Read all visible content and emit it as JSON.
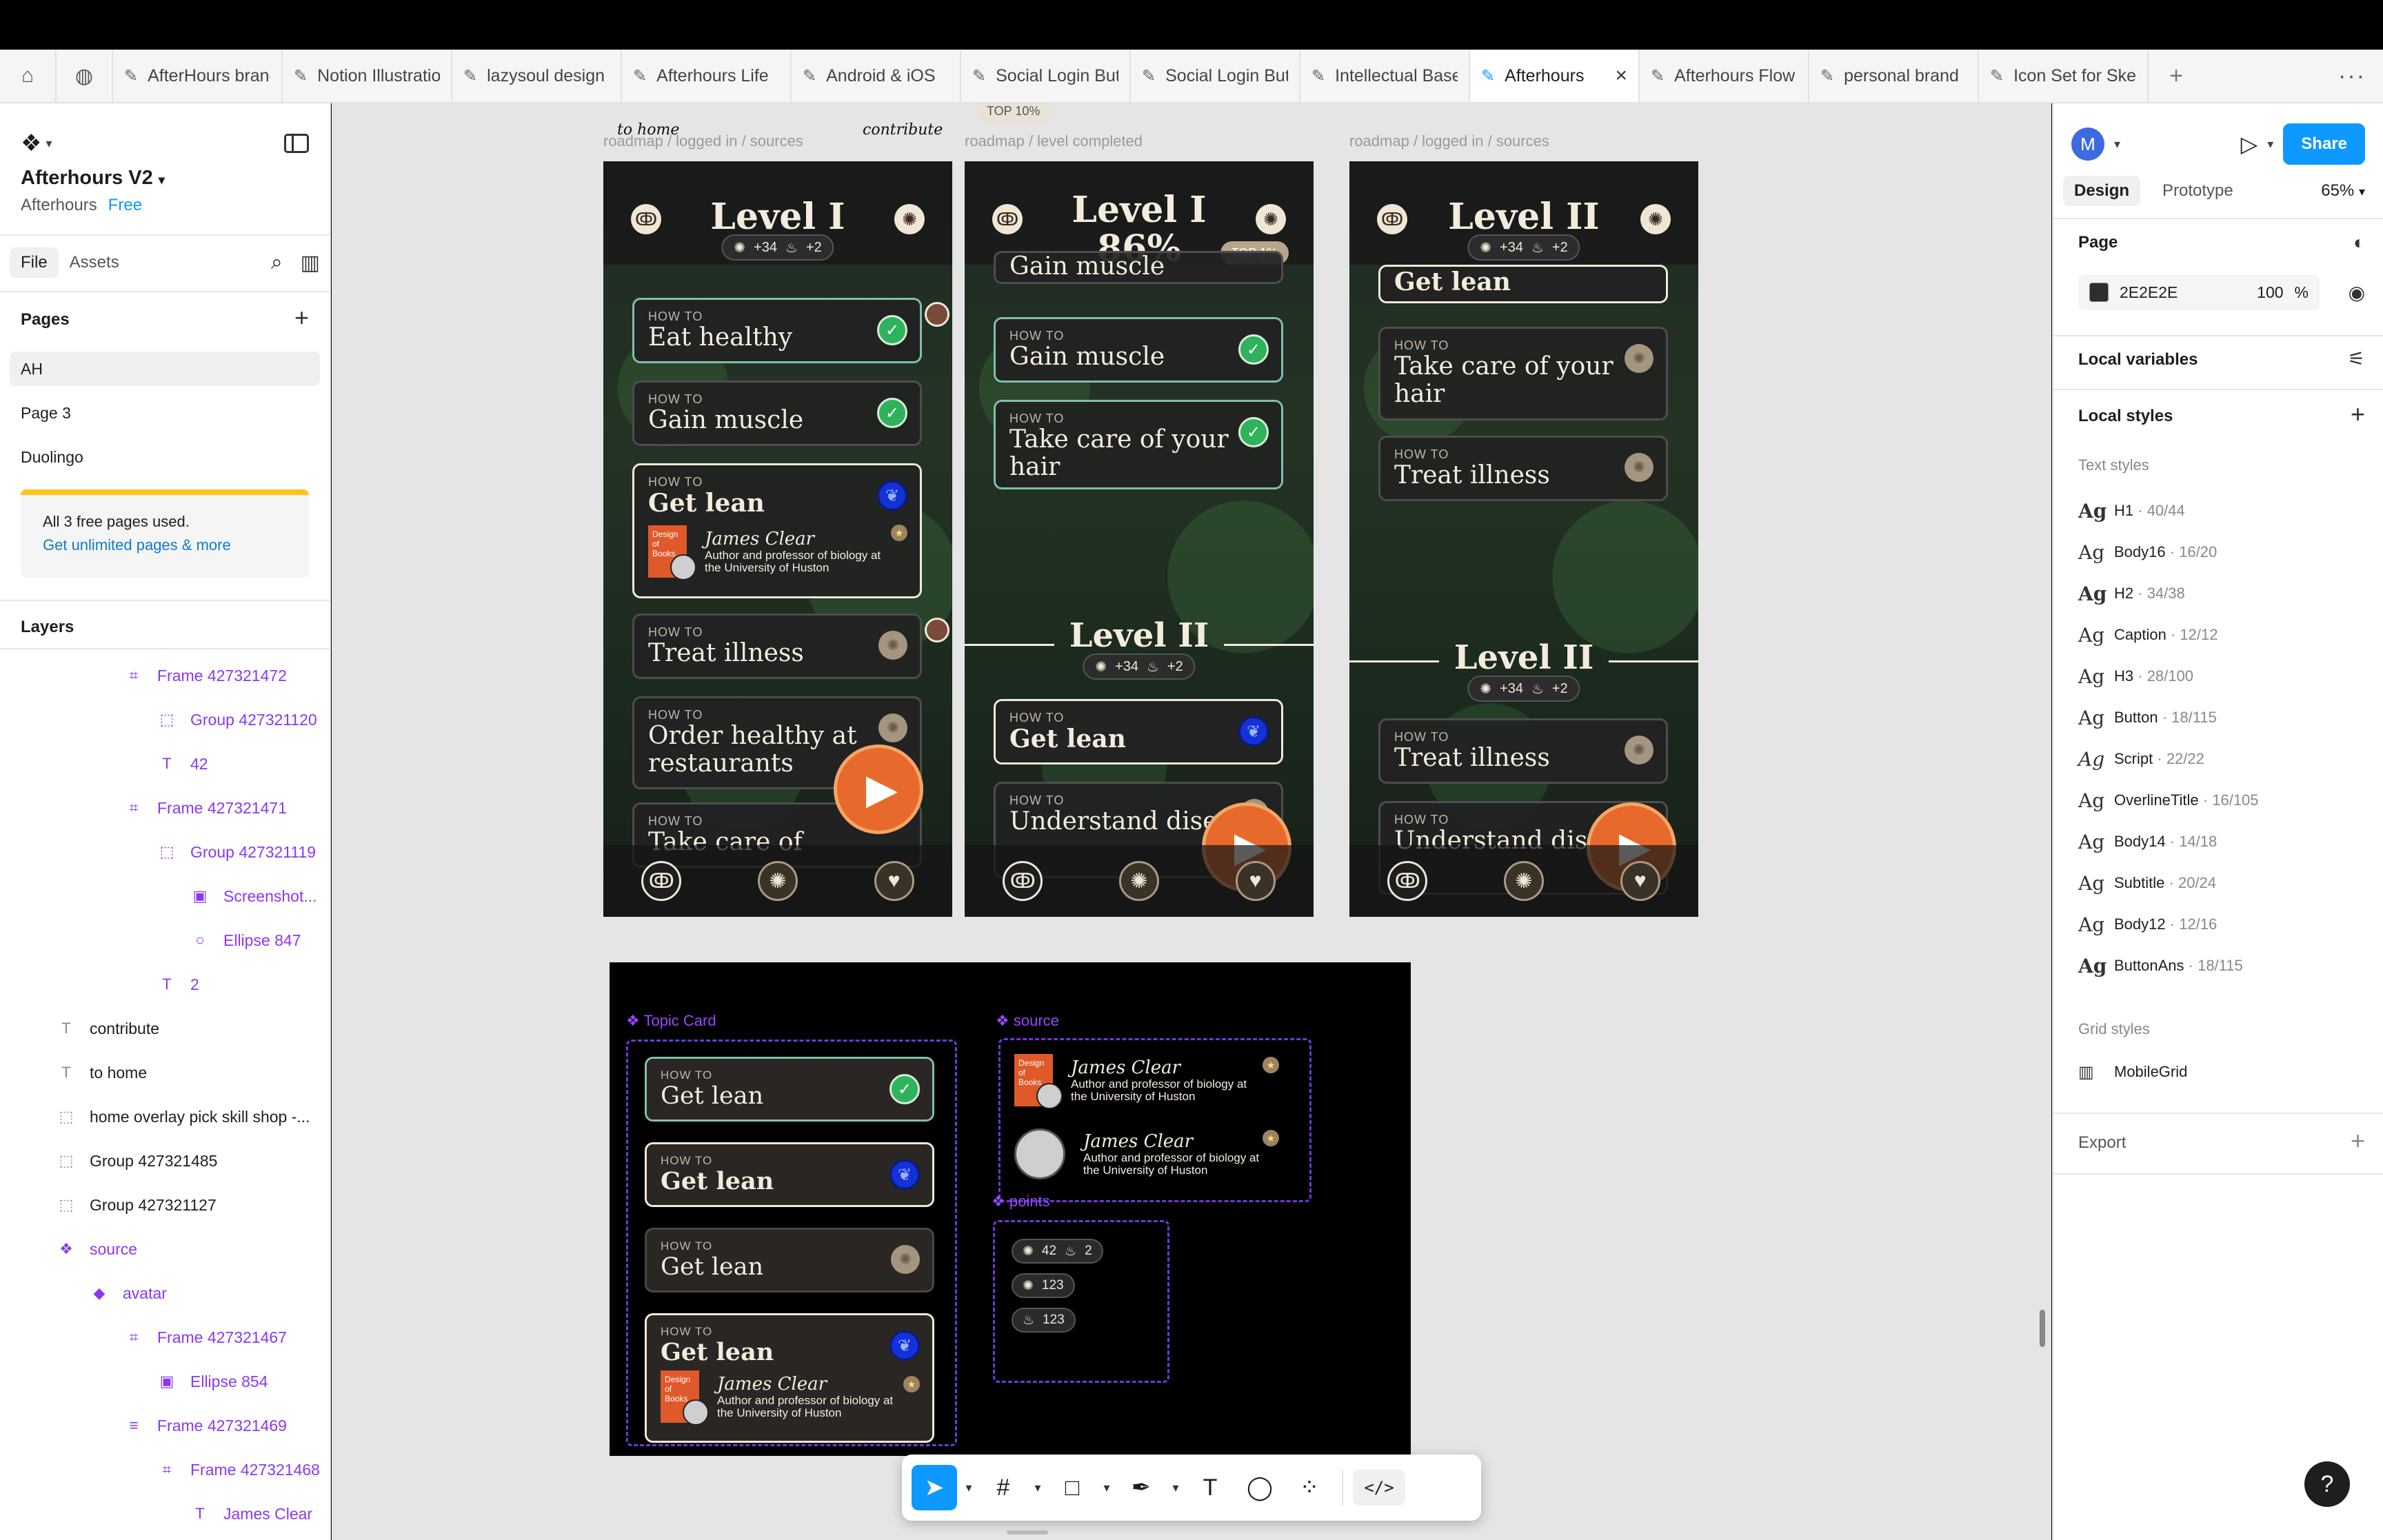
{
  "tabs": {
    "items": [
      {
        "label": "AfterHours brand"
      },
      {
        "label": "Notion Illustration"
      },
      {
        "label": "lazysoul design"
      },
      {
        "label": "Afterhours Life"
      },
      {
        "label": "Android & iOS"
      },
      {
        "label": "Social Login Button"
      },
      {
        "label": "Social Login Button"
      },
      {
        "label": "Intellectual Base"
      },
      {
        "label": "Afterhours"
      },
      {
        "label": "Afterhours Flow"
      },
      {
        "label": "personal brand"
      },
      {
        "label": "Icon Set for Sketch"
      }
    ]
  },
  "left_panel": {
    "project_title": "Afterhours V2",
    "team": "Afterhours",
    "plan": "Free",
    "tab_file": "File",
    "tab_assets": "Assets",
    "pages_heading": "Pages",
    "pages": [
      "AH",
      "Page 3",
      "Duolingo"
    ],
    "upsell_line1": "All 3 free pages used.",
    "upsell_line2": "Get unlimited pages & more",
    "layers_heading": "Layers",
    "layers": [
      {
        "name": "Frame 427321472",
        "icon": "frame-icon"
      },
      {
        "name": "Group 427321120",
        "icon": "group-icon"
      },
      {
        "name": "42",
        "icon": "text-icon"
      },
      {
        "name": "Frame 427321471",
        "icon": "frame-icon"
      },
      {
        "name": "Group 427321119",
        "icon": "group-icon"
      },
      {
        "name": "Screenshot...",
        "icon": "image-icon"
      },
      {
        "name": "Ellipse 847",
        "icon": "ellipse-icon"
      },
      {
        "name": "2",
        "icon": "text-icon"
      },
      {
        "name": "contribute",
        "icon": "text-icon"
      },
      {
        "name": "to home",
        "icon": "text-icon"
      },
      {
        "name": "home overlay pick skill shop -...",
        "icon": "group-icon"
      },
      {
        "name": "Group 427321485",
        "icon": "group-icon"
      },
      {
        "name": "Group 427321127",
        "icon": "group-icon"
      },
      {
        "name": "source",
        "icon": "component-icon"
      },
      {
        "name": "avatar",
        "icon": "instance-icon"
      },
      {
        "name": "Frame 427321467",
        "icon": "frame-icon"
      },
      {
        "name": "Ellipse 854",
        "icon": "image-icon"
      },
      {
        "name": "Frame 427321469",
        "icon": "frame-icon"
      },
      {
        "name": "Frame 427321468",
        "icon": "frame-icon"
      },
      {
        "name": "James Clear",
        "icon": "text-icon"
      }
    ]
  },
  "canvas": {
    "script_to_home": "to home",
    "script_contribute": "contribute",
    "frame_labels": [
      "roadmap / logged in / sources",
      "roadmap / level completed",
      "roadmap / logged in / sources"
    ],
    "top_badge_partial": "TOP 10%",
    "how_to": "HOW TO",
    "phone1": {
      "level": "Level I",
      "points": "34",
      "streak": "2",
      "cards": [
        "Eat healthy",
        "Gain muscle",
        "Get lean",
        "Treat illness",
        "Order healthy at restaurants",
        "Take care of"
      ],
      "source_name": "James Clear",
      "source_desc_1": "Author and professor of biology at",
      "source_desc_2": "the University of Huston",
      "book_title": "Design of Books"
    },
    "phone2": {
      "level": "Level I",
      "percent": "86%",
      "top_badge": "TOP 1%",
      "points": "34",
      "streak": "2",
      "cards_top": [
        "Gain muscle",
        "Gain muscle",
        "Take care of your hair"
      ],
      "level2": "Level II",
      "cards_bottom": [
        "Get lean",
        "Understand disease"
      ]
    },
    "phone3": {
      "level": "Level II",
      "points": "34",
      "streak": "2",
      "cards_top": [
        "Get lean",
        "Take care of your hair",
        "Treat illness"
      ],
      "level2": "Level II",
      "cards_bottom": [
        "Treat illness",
        "Understand disease"
      ]
    },
    "components": {
      "topic_card_label": "Topic Card",
      "source_label": "source",
      "points_label": "points",
      "card_title": "Get lean",
      "source_name": "James Clear",
      "source_desc_1": "Author and professor of biology at",
      "source_desc_2": "the University of Huston",
      "chip1_points": "42",
      "chip1_streak": "2",
      "chip2_points": "123",
      "chip3_streak": "123"
    }
  },
  "right_panel": {
    "avatar_letter": "M",
    "share": "Share",
    "tab_design": "Design",
    "tab_prototype": "Prototype",
    "zoom": "65%",
    "page_heading": "Page",
    "page_color": "2E2E2E",
    "page_opacity": "100",
    "percent_sign": "%",
    "local_variables": "Local variables",
    "local_styles": "Local styles",
    "text_styles_heading": "Text styles",
    "text_styles": [
      {
        "name": "H1",
        "meta": "40/44"
      },
      {
        "name": "Body16",
        "meta": "16/20"
      },
      {
        "name": "H2",
        "meta": "34/38"
      },
      {
        "name": "Caption",
        "meta": "12/12"
      },
      {
        "name": "H3",
        "meta": "28/100"
      },
      {
        "name": "Button",
        "meta": "18/115"
      },
      {
        "name": "Script",
        "meta": "22/22"
      },
      {
        "name": "OverlineTitle",
        "meta": "16/105"
      },
      {
        "name": "Body14",
        "meta": "14/18"
      },
      {
        "name": "Subtitle",
        "meta": "20/24"
      },
      {
        "name": "Body12",
        "meta": "12/16"
      },
      {
        "name": "ButtonAns",
        "meta": "18/115"
      }
    ],
    "grid_styles_heading": "Grid styles",
    "grid_style": "MobileGrid",
    "export": "Export",
    "help": "?"
  },
  "colors": {
    "figma_blue": "#0d99ff",
    "component_purple": "#9747ff",
    "play_orange": "#e76a2c",
    "check_green": "#2fb25c",
    "leaf_blue": "#1232d8",
    "page_bg": "#2E2E2E"
  }
}
